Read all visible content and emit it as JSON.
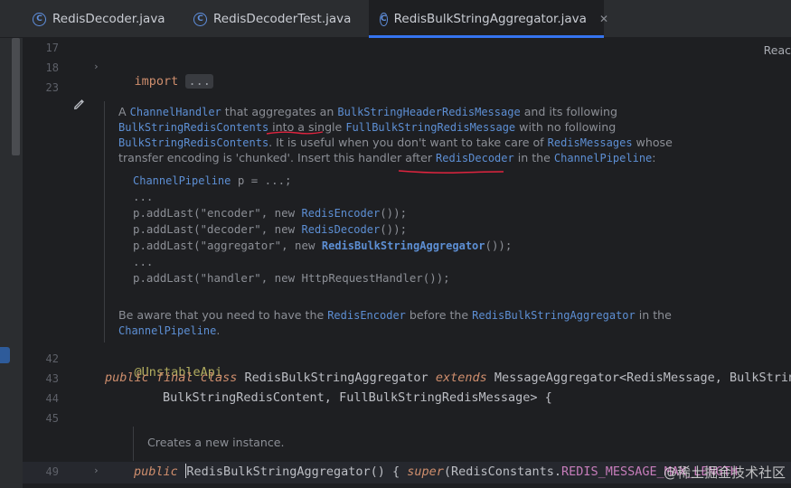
{
  "tabs": [
    {
      "label": "RedisDecoder.java",
      "icon": "java-class-icon"
    },
    {
      "label": "RedisDecoderTest.java",
      "icon": "java-class-icon"
    },
    {
      "label": "RedisBulkStringAggregator.java",
      "icon": "java-class-icon",
      "active": true
    }
  ],
  "tab_icon_letter": "C",
  "close_glyph": "✕",
  "reader_mode_label": "Reac",
  "line_numbers": {
    "l17": "17",
    "l18": "18",
    "l23": "23",
    "l42": "42",
    "l43": "43",
    "l44": "44",
    "l45": "45",
    "l49": "49"
  },
  "code": {
    "import_kw": "import",
    "import_fold": "...",
    "annotation": "@UnstableApi",
    "l43_public": "public",
    "l43_final": "final",
    "l43_class": "class",
    "l43_name": "RedisBulkStringAggregator",
    "l43_extends": "extends",
    "l43_rest": "MessageAggregator<RedisMessage, BulkString",
    "l44_text": "BulkStringRedisContent, FullBulkStringRedisMessage> {",
    "l49_public": "public",
    "l49_ctor": "RedisBulkStringAggregator() { ",
    "l49_super": "super",
    "l49_args": "(RedisConstants.",
    "l49_const": "REDIS_MESSAGE_MAX_LENGTH"
  },
  "doc": {
    "p1_a": "A ",
    "p1_link1": "ChannelHandler",
    "p1_b": " that aggregates an ",
    "p1_link2": "BulkStringHeaderRedisMessage",
    "p1_c": " and its following",
    "p2_link1": "BulkStringRedisContents",
    "p2_a": " into a single ",
    "p2_link2": "FullBulkStringRedisMessage",
    "p2_b": " with no following",
    "p3_link1": "BulkStringRedisContents",
    "p3_a": ". It is useful when you don't want to take care of ",
    "p3_link2": "RedisMessages",
    "p3_b": " whose",
    "p4_a": "transfer encoding is 'chunked'. Insert this handler after ",
    "p4_link1": "RedisDecoder",
    "p4_b": " in the ",
    "p4_link2": "ChannelPipeline",
    "p4_c": ":",
    "ex1_link": "ChannelPipeline",
    "ex1_rest": " p = ...;",
    "ex2": "...",
    "ex3_a": "p.addLast(\"encoder\", new ",
    "ex3_link": "RedisEncoder",
    "ex3_b": "());",
    "ex4_a": "p.addLast(\"decoder\", new ",
    "ex4_link": "RedisDecoder",
    "ex4_b": "());",
    "ex5_a": "p.addLast(\"aggregator\", new ",
    "ex5_link": "RedisBulkStringAggregator",
    "ex5_b": "());",
    "ex6": "...",
    "ex7": "p.addLast(\"handler\", new HttpRequestHandler());",
    "p5_a": "Be aware that you need to have the ",
    "p5_link1": "RedisEncoder",
    "p5_b": " before the ",
    "p5_link2": "RedisBulkStringAggregator",
    "p5_c": " in the",
    "p6_link": "ChannelPipeline",
    "p6_a": ".",
    "ctor_doc": "Creates a new instance."
  },
  "watermark": "@稀土掘金技术社区",
  "colors": {
    "keyword": "#cf8e6d",
    "link": "#5d8fd4",
    "annotation": "#b3ae60",
    "constant": "#c77dbb",
    "annotation_marker": "#e0243f",
    "active_tab_underline": "#3574f0"
  }
}
